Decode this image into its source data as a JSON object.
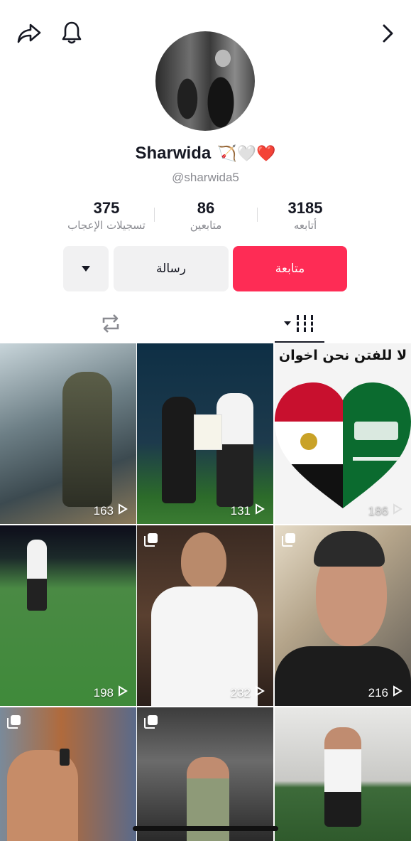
{
  "profile": {
    "display_name": "Sharwida",
    "emoji": "🏹🤍❤️",
    "username": "@sharwida5"
  },
  "stats": {
    "likes": {
      "value": "375",
      "label": "تسجيلات الإعجاب"
    },
    "followers": {
      "value": "86",
      "label": "متابعين"
    },
    "following": {
      "value": "3185",
      "label": "أتابعه"
    }
  },
  "buttons": {
    "follow_label": "متابعة",
    "message_label": "رسالة"
  },
  "grid": {
    "tiles": [
      {
        "views": "163",
        "multi": false
      },
      {
        "views": "131",
        "multi": false
      },
      {
        "views": "186",
        "multi": false,
        "overlay_text": "لا للفتن نحن اخوان"
      },
      {
        "views": "198",
        "multi": false
      },
      {
        "views": "232",
        "multi": true
      },
      {
        "views": "216",
        "multi": true
      },
      {
        "views": "",
        "multi": true
      },
      {
        "views": "",
        "multi": true
      },
      {
        "views": "",
        "multi": false
      }
    ]
  },
  "colors": {
    "accent": "#fe2c55",
    "secondary_bg": "#f1f1f2",
    "muted_text": "#8a8b91"
  },
  "icons": [
    "share-icon",
    "bell-icon",
    "chevron-right-icon",
    "caret-down-icon",
    "repost-icon",
    "grid-icon"
  ]
}
